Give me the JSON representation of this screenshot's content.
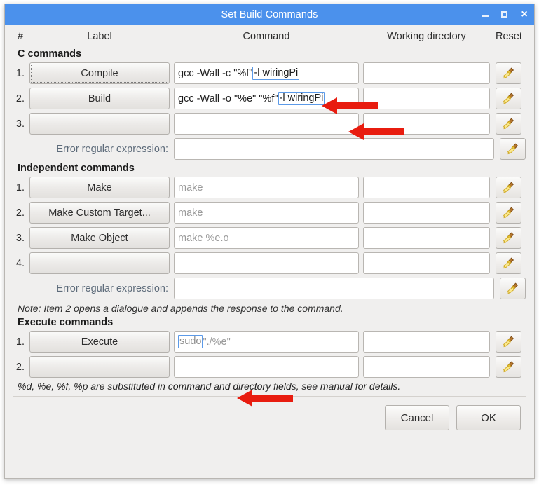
{
  "window": {
    "title": "Set Build Commands",
    "controls": {
      "minimize": "minimize-button",
      "maximize": "maximize-button",
      "close": "×"
    }
  },
  "header": {
    "number": "#",
    "label": "Label",
    "command": "Command",
    "working_directory": "Working directory",
    "reset": "Reset"
  },
  "sections": {
    "c_commands": {
      "title": "C commands",
      "rows": [
        {
          "number": "1.",
          "label": "Compile",
          "command_prefix": "gcc -Wall -c \"%f\"",
          "command_highlight": "-l wiringPi",
          "command_suffix": "",
          "directory": "",
          "focused": true
        },
        {
          "number": "2.",
          "label": "Build",
          "command_prefix": "gcc -Wall -o \"%e\" \"%f\"",
          "command_highlight": "-l wiringPi",
          "command_suffix": "",
          "directory": "",
          "focused": false
        },
        {
          "number": "3.",
          "label": "",
          "command_prefix": "",
          "command_highlight": "",
          "command_suffix": "",
          "directory": "",
          "focused": false
        }
      ],
      "error_regex_label": "Error regular expression:",
      "error_regex_value": ""
    },
    "independent_commands": {
      "title": "Independent commands",
      "rows": [
        {
          "number": "1.",
          "label": "Make",
          "command_placeholder": "make",
          "directory": ""
        },
        {
          "number": "2.",
          "label": "Make Custom Target...",
          "command_placeholder": "make",
          "directory": ""
        },
        {
          "number": "3.",
          "label": "Make Object",
          "command_placeholder": "make %e.o",
          "directory": ""
        },
        {
          "number": "4.",
          "label": "",
          "command_placeholder": "",
          "directory": ""
        }
      ],
      "error_regex_label": "Error regular expression:",
      "error_regex_value": "",
      "note": "Note: Item 2 opens a dialogue and appends the response to the command."
    },
    "execute_commands": {
      "title": "Execute commands",
      "rows": [
        {
          "number": "1.",
          "label": "Execute",
          "command_highlight": "sudo",
          "command_rest": "\"./%e\"",
          "directory": ""
        },
        {
          "number": "2.",
          "label": "",
          "command_highlight": "",
          "command_rest": "",
          "directory": ""
        }
      ]
    }
  },
  "footnote": "%d, %e, %f, %p are substituted in command and directory fields, see manual for details.",
  "actions": {
    "cancel": "Cancel",
    "ok": "OK"
  },
  "icons": {
    "reset": "broom-icon"
  },
  "colors": {
    "titlebar": "#4b91ec",
    "dialog_background": "#f0efee",
    "highlight_border": "#5c9ae8",
    "annotation_arrow": "#e81c0f",
    "placeholder_text": "#9a9a9a"
  }
}
